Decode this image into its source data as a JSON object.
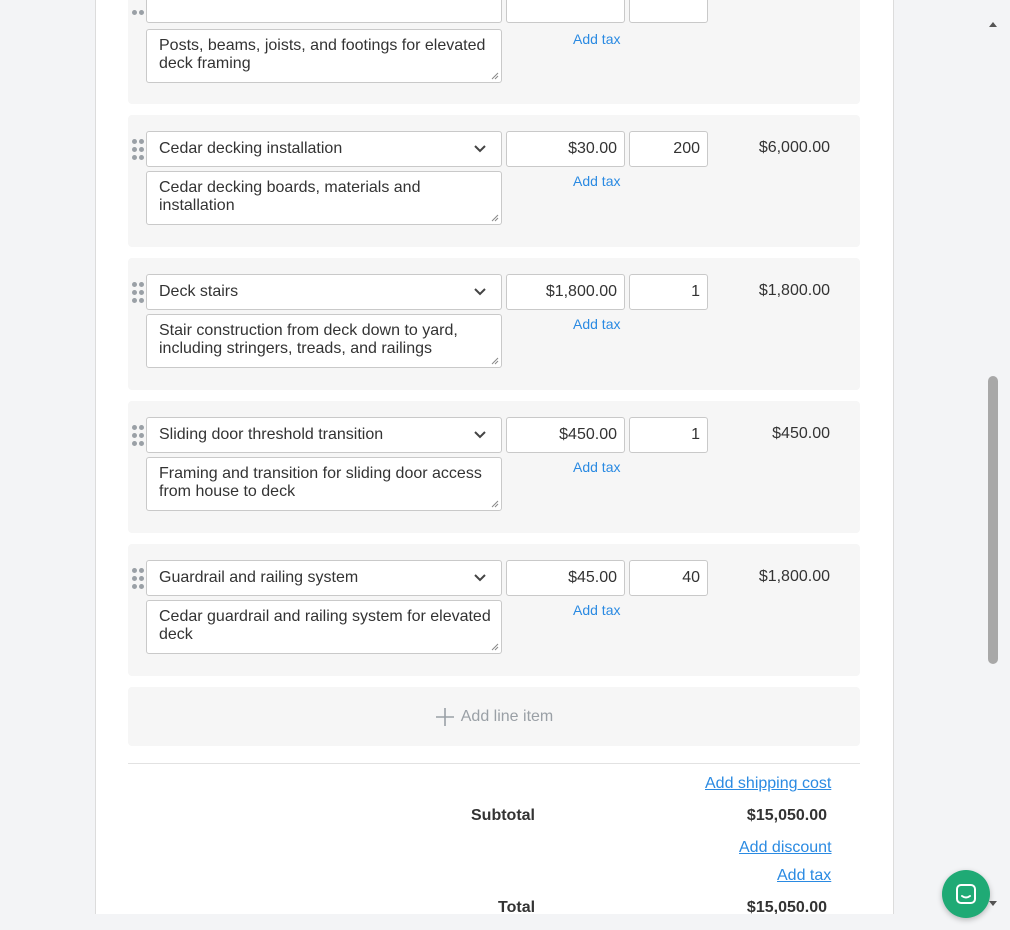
{
  "line_items": [
    {
      "name": "",
      "description": "Posts, beams, joists, and footings for elevated deck framing",
      "price": "",
      "qty": "",
      "total": "",
      "add_tax": "Add tax"
    },
    {
      "name": "Cedar decking installation",
      "description": "Cedar decking boards, materials and installation",
      "price": "$30.00",
      "qty": "200",
      "total": "$6,000.00",
      "add_tax": "Add tax"
    },
    {
      "name": "Deck stairs",
      "description": "Stair construction from deck down to yard, including stringers, treads, and railings",
      "price": "$1,800.00",
      "qty": "1",
      "total": "$1,800.00",
      "add_tax": "Add tax"
    },
    {
      "name": "Sliding door threshold transition",
      "description": "Framing and transition for sliding door access from house to deck",
      "price": "$450.00",
      "qty": "1",
      "total": "$450.00",
      "add_tax": "Add tax"
    },
    {
      "name": "Guardrail and railing system",
      "description": "Cedar guardrail and railing system for elevated deck",
      "price": "$45.00",
      "qty": "40",
      "total": "$1,800.00",
      "add_tax": "Add tax"
    }
  ],
  "add_line_item": "Add line item",
  "summary": {
    "add_shipping": "Add shipping cost",
    "subtotal_label": "Subtotal",
    "subtotal_value": "$15,050.00",
    "add_discount": "Add discount",
    "add_tax": "Add tax",
    "total_label": "Total",
    "total_value": "$15,050.00"
  },
  "colors": {
    "link": "#2a8ae2",
    "chat_button": "#1faa75",
    "row_background": "#f6f6f6"
  },
  "icons": {
    "drag": "drag-handle-icon",
    "dropdown": "chevron-down-icon",
    "add": "plus-icon",
    "chat": "chat-icon"
  }
}
